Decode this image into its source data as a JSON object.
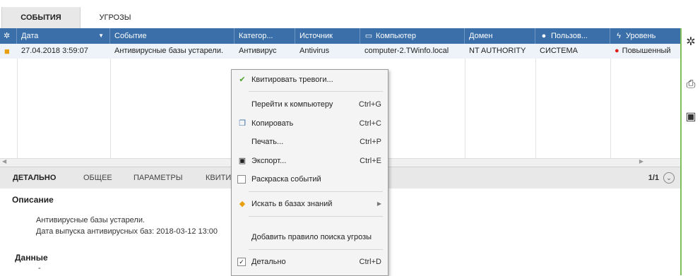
{
  "top_tabs": [
    "СОБЫТИЯ",
    "УГРОЗЫ"
  ],
  "columns": [
    {
      "label": "",
      "icon": "gear-icon"
    },
    {
      "label": "Дата",
      "icon": "",
      "sort": "▼"
    },
    {
      "label": "Событие",
      "icon": ""
    },
    {
      "label": "Категор...",
      "icon": ""
    },
    {
      "label": "Источник",
      "icon": ""
    },
    {
      "label": "Компьютер",
      "icon": "monitor-icon"
    },
    {
      "label": "Домен",
      "icon": ""
    },
    {
      "label": "Пользов...",
      "icon": "user-icon"
    },
    {
      "label": "Уровень",
      "icon": "lightning-icon"
    }
  ],
  "row": {
    "icon": "lock-icon",
    "date": "27.04.2018 3:59:07",
    "event": "Антивирусные базы устарели.",
    "category": "Антивирус",
    "source": "Antivirus",
    "computer": "computer-2.TWinfo.local",
    "domain": "NT AUTHORITY",
    "user": "СИСТЕМА",
    "level": "Повышенный",
    "level_color": "#e0201a"
  },
  "bottom_tabs": [
    "ДЕТАЛЬНО",
    "ОБЩЕЕ",
    "ПАРАМЕТРЫ",
    "КВИТИ"
  ],
  "pager": "1/1",
  "detail": {
    "description_title": "Описание",
    "line1": "Антивирусные базы устарели.",
    "line2": "Дата выпуска антивирусных баз: 2018-03-12 13:00",
    "data_title": "Данные",
    "data_value": "-"
  },
  "menu": {
    "ack": "Квитировать тревоги...",
    "goto": "Перейти к компьютеру",
    "goto_sc": "Ctrl+G",
    "copy": "Копировать",
    "copy_sc": "Ctrl+C",
    "print": "Печать...",
    "print_sc": "Ctrl+P",
    "export": "Экспорт...",
    "export_sc": "Ctrl+E",
    "coloring": "Раскраска событий",
    "search_kb": "Искать в базах знаний",
    "add_rule": "Добавить правило поиска угрозы",
    "detailed": "Детально",
    "detailed_sc": "Ctrl+D"
  },
  "colors": {
    "header": "#3a6fa9",
    "accent_green": "#7fbf5a"
  }
}
